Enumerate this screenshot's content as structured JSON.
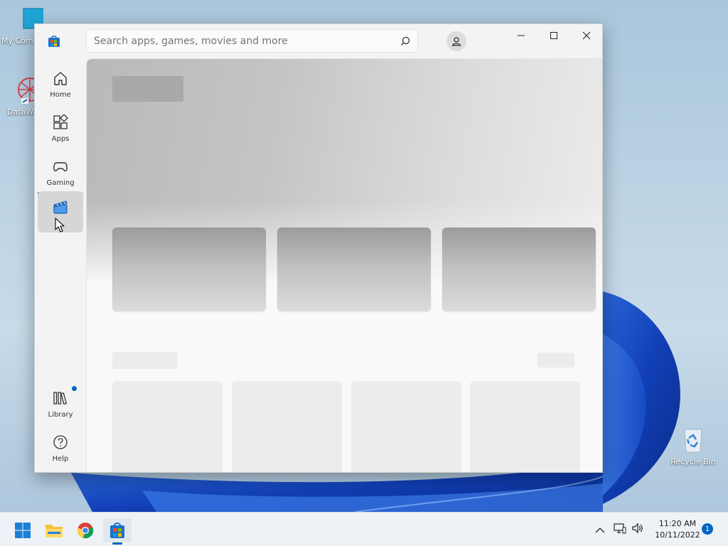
{
  "desktop": {
    "icons": [
      {
        "label": "My Com"
      },
      {
        "label": "DataWag"
      },
      {
        "label": "Recycle Bin"
      }
    ]
  },
  "window": {
    "search": {
      "placeholder": "Search apps, games, movies and more"
    },
    "nav": [
      {
        "label": "Home",
        "icon": "home-icon"
      },
      {
        "label": "Apps",
        "icon": "apps-icon"
      },
      {
        "label": "Gaming",
        "icon": "gaming-icon"
      },
      {
        "label": "",
        "icon": "movies-tv-icon",
        "selected": true
      },
      {
        "label": "Library",
        "icon": "library-icon"
      },
      {
        "label": "Help",
        "icon": "help-icon"
      }
    ]
  },
  "taskbar": {
    "time": "11:20 AM",
    "date": "10/11/2022",
    "notifications": "1"
  },
  "colors": {
    "accent": "#0067c0"
  }
}
